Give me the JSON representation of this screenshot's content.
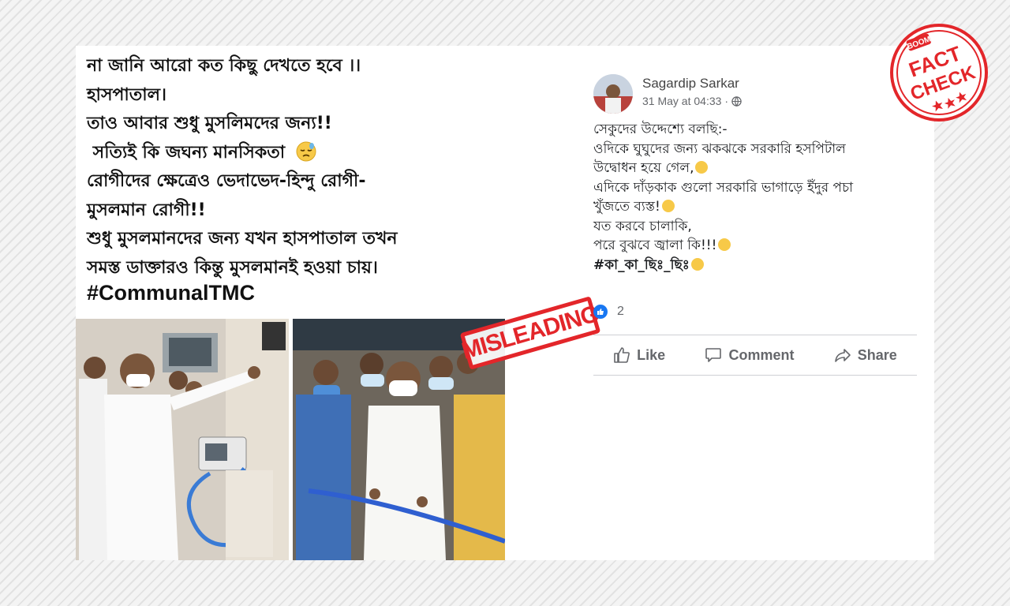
{
  "image_caption": {
    "lines": [
      "না জানি আরো কত কিছু দেখতে হবে ।।",
      "হাসপাতাল।",
      "তাও আবার শুধু মুসলিমদের জন্য!!",
      "সত্যিই কি জঘন্য মানসিকতা",
      "রোগীদের ক্ষেত্রেও ভেদাভেদ-হিন্দু রোগী-",
      "মুসলমান রোগী!!",
      "শুধু মুসলমানদের জন্য যখন হাসপাতাল তখন",
      "সমস্ত ডাক্তারও কিন্তু মুসলমানই হওয়া চায়।"
    ],
    "hashtag": "#CommunalTMC"
  },
  "stamps": {
    "misleading": "MISLEADING",
    "boom": "BOOM",
    "fact": "FACT",
    "check": "CHECK",
    "stamp_color": "#e3262a"
  },
  "post": {
    "author": "Sagardip Sarkar",
    "timestamp": "31 May at 04:33",
    "separator": "·",
    "privacy_icon": "globe-icon",
    "body_lines": [
      "সেকুদের উদ্দেশ্যে বলছি:-",
      "ওদিকে ঘুঘুদের জন্য ঝকঝকে সরকারি হসপিটাল",
      "উদ্বোধন হয়ে গেল,",
      "এদিকে দাঁড়কাক গুলো সরকারি ভাগাড়ে ইঁদুর পচা",
      "খুঁজতে ব্যস্ত!",
      "যত করবে চালাকি,",
      "পরে বুঝবে জ্বালা কি!!!"
    ],
    "hashtag": "#কা_কা_ছিঃ_ছিঃ",
    "reaction_count": "2",
    "actions": {
      "like": "Like",
      "comment": "Comment",
      "share": "Share"
    },
    "accent_color": "#1877f2"
  }
}
